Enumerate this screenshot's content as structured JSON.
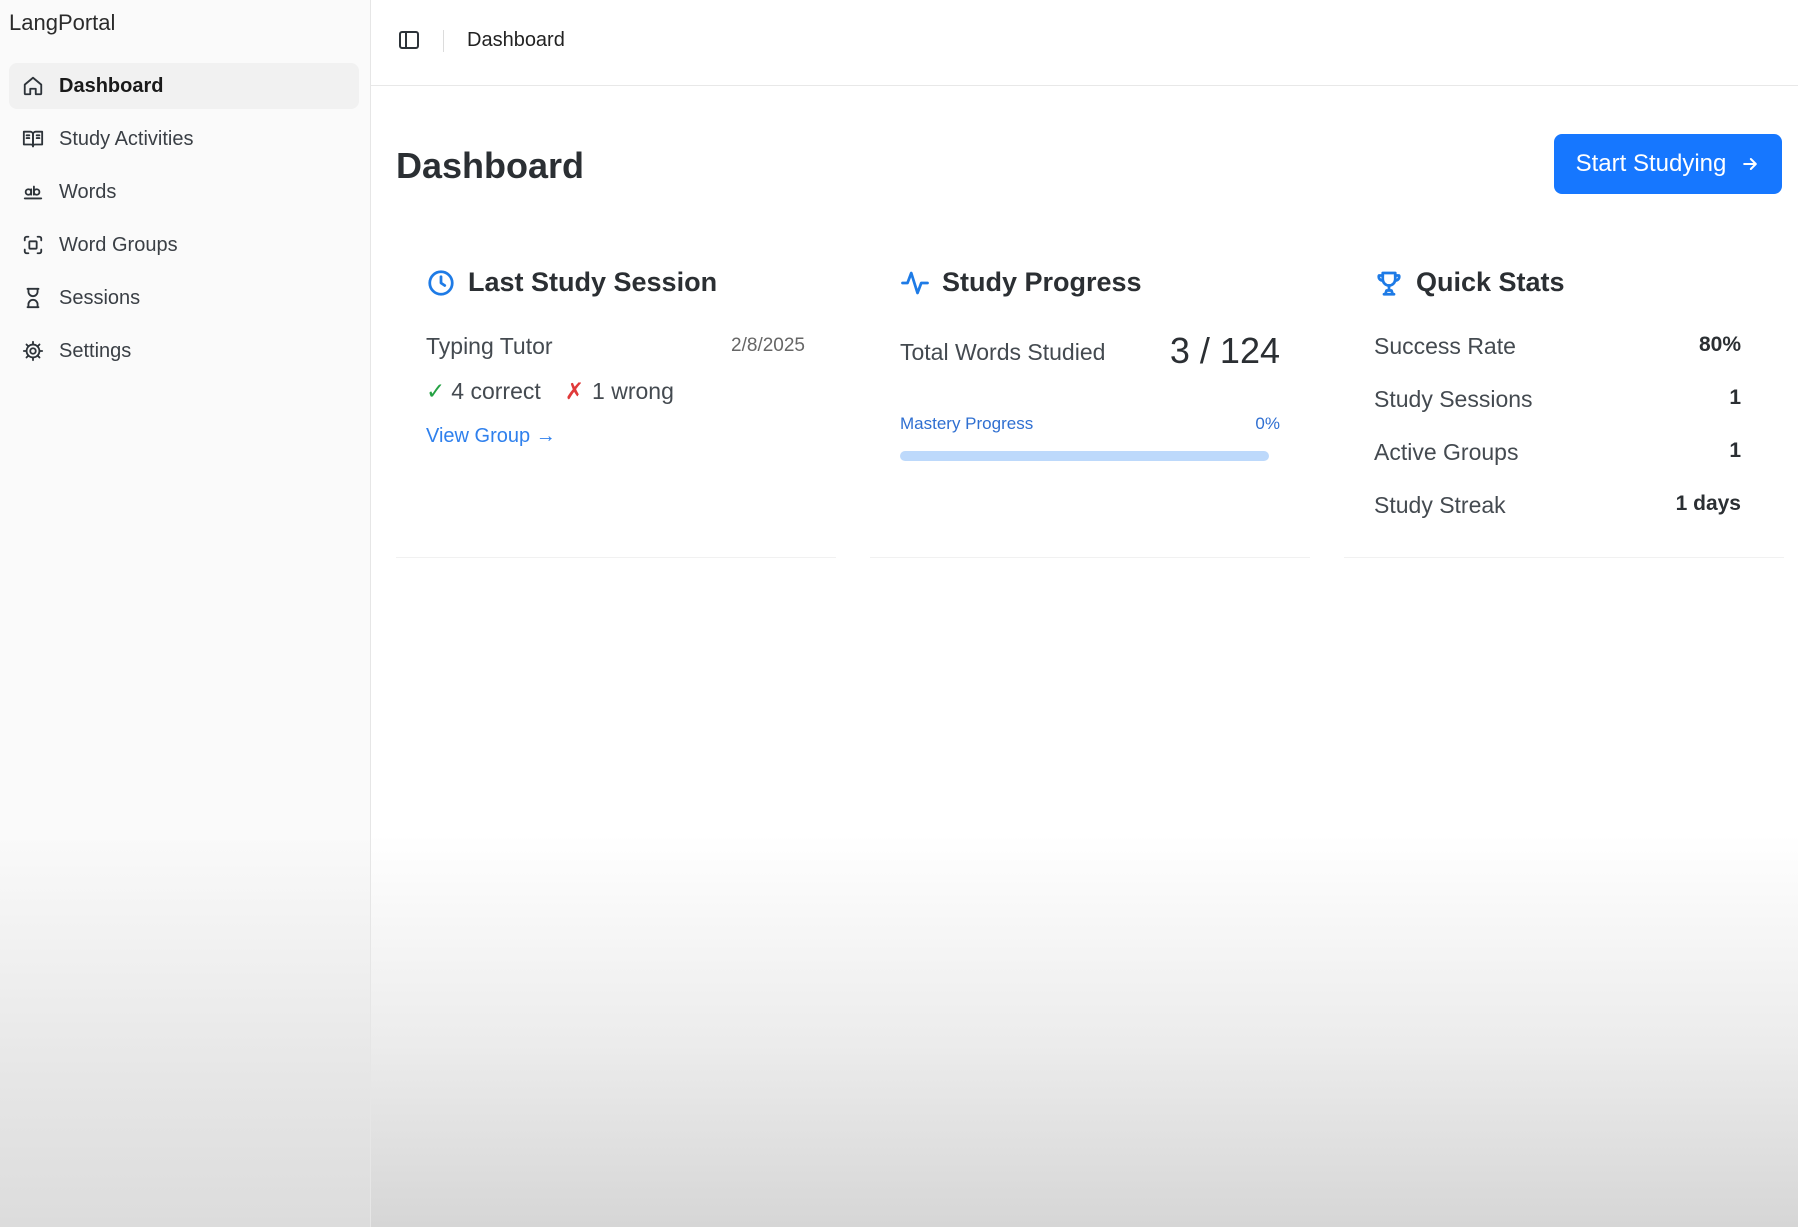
{
  "brand": "LangPortal",
  "sidebar": {
    "items": [
      {
        "label": "Dashboard",
        "icon": "home-icon"
      },
      {
        "label": "Study Activities",
        "icon": "book-open-icon"
      },
      {
        "label": "Words",
        "icon": "spell-check-icon"
      },
      {
        "label": "Word Groups",
        "icon": "scan-text-icon"
      },
      {
        "label": "Sessions",
        "icon": "hourglass-icon"
      },
      {
        "label": "Settings",
        "icon": "gear-icon"
      }
    ]
  },
  "topbar": {
    "breadcrumb": "Dashboard",
    "toggle_icon": "panel-left-icon"
  },
  "page": {
    "title": "Dashboard",
    "start_button": "Start Studying"
  },
  "last_session": {
    "title": "Last Study Session",
    "activity": "Typing Tutor",
    "date": "2/8/2025",
    "correct_mark": "✓",
    "correct": "4 correct",
    "wrong_mark": "✗",
    "wrong": "1 wrong",
    "link": "View Group →"
  },
  "study_progress": {
    "title": "Study Progress",
    "total_label": "Total Words Studied",
    "total_value": "3 / 124",
    "mastery_label": "Mastery Progress",
    "mastery_value": "0%",
    "mastery_fraction": 0
  },
  "quick_stats": {
    "title": "Quick Stats",
    "rows": [
      {
        "label": "Success Rate",
        "value": "80%"
      },
      {
        "label": "Study Sessions",
        "value": "1"
      },
      {
        "label": "Active Groups",
        "value": "1"
      },
      {
        "label": "Study Streak",
        "value": "1 days"
      }
    ]
  },
  "colors": {
    "accent": "#1677ff",
    "correct": "#25a244",
    "wrong": "#e03a3a",
    "link": "#2f80ed"
  }
}
